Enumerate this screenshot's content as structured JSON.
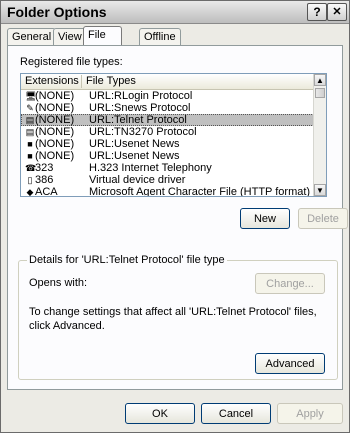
{
  "window": {
    "title": "Folder Options",
    "help_glyph": "?",
    "close_glyph": "✕"
  },
  "tabs": [
    {
      "label": "General"
    },
    {
      "label": "View"
    },
    {
      "label": "File Types"
    },
    {
      "label": "Offline Files"
    }
  ],
  "file_types": {
    "section_label": "Registered file types:",
    "columns": {
      "extensions": "Extensions",
      "file_types": "File Types"
    },
    "rows": [
      {
        "ext": "(NONE)",
        "type": "URL:RLogin Protocol"
      },
      {
        "ext": "(NONE)",
        "type": "URL:Snews Protocol"
      },
      {
        "ext": "(NONE)",
        "type": "URL:Telnet Protocol"
      },
      {
        "ext": "(NONE)",
        "type": "URL:TN3270 Protocol"
      },
      {
        "ext": "(NONE)",
        "type": "URL:Usenet News"
      },
      {
        "ext": "(NONE)",
        "type": "URL:Usenet News"
      },
      {
        "ext": "323",
        "type": "H.323 Internet Telephony"
      },
      {
        "ext": "386",
        "type": "Virtual device driver"
      },
      {
        "ext": "ACA",
        "type": "Microsoft Agent Character File (HTTP format)"
      }
    ],
    "selected_row": "URL:Telnet Protocol",
    "scroll_up": "▲",
    "scroll_down": "▼"
  },
  "buttons": {
    "new": "New",
    "delete": "Delete"
  },
  "details": {
    "legend": "Details for 'URL:Telnet Protocol' file type",
    "opens_with_label": "Opens with:",
    "change_button": "Change...",
    "info_text": "To change settings that affect all 'URL:Telnet Protocol' files, click Advanced.",
    "advanced_button": "Advanced"
  },
  "footer": {
    "ok": "OK",
    "cancel": "Cancel",
    "apply": "Apply"
  }
}
